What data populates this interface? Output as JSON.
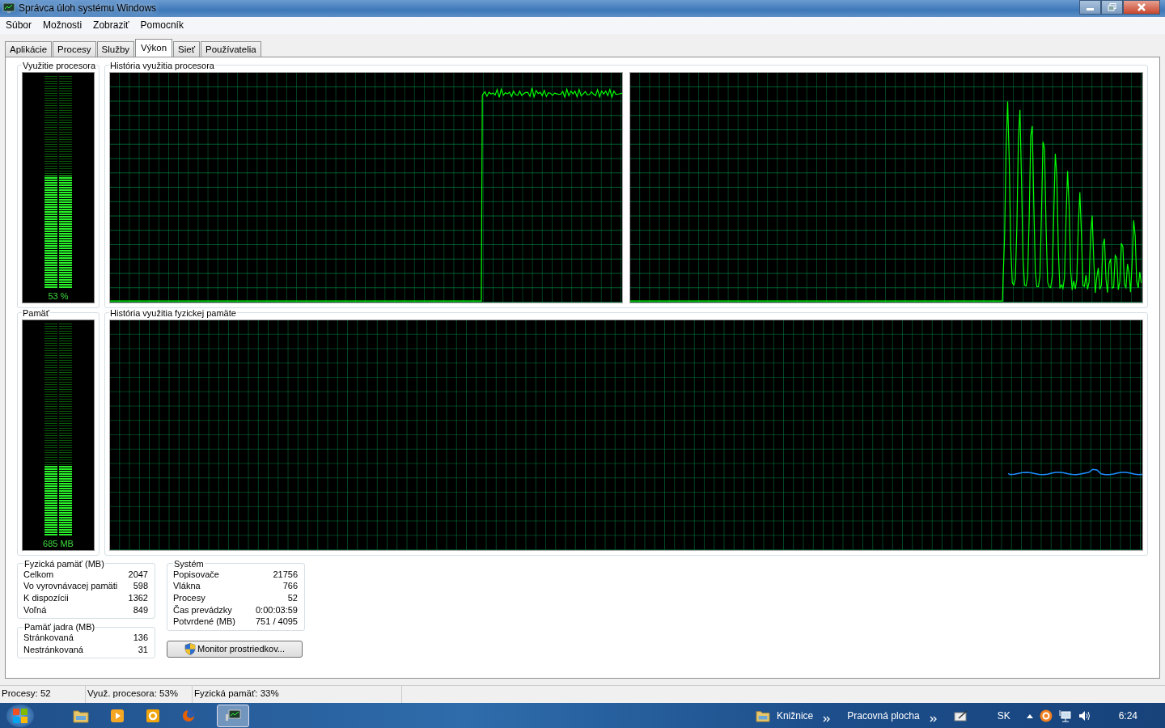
{
  "window": {
    "title": "Správca úloh systému Windows"
  },
  "menu": [
    "Súbor",
    "Možnosti",
    "Zobraziť",
    "Pomocník"
  ],
  "tabs": [
    {
      "label": "Aplikácie",
      "selected": false
    },
    {
      "label": "Procesy",
      "selected": false
    },
    {
      "label": "Služby",
      "selected": false
    },
    {
      "label": "Výkon",
      "selected": true
    },
    {
      "label": "Sieť",
      "selected": false
    },
    {
      "label": "Používatelia",
      "selected": false
    }
  ],
  "cpu_usage": {
    "title": "Využitie procesora",
    "reading": "53 %",
    "level": 0.53
  },
  "cpu_history": {
    "title": "História využitia procesora"
  },
  "memory": {
    "title": "Pamäť",
    "reading": "685 MB",
    "level": 0.33
  },
  "memory_history": {
    "title": "História využitia fyzickej pamäte"
  },
  "physical_memory": {
    "title": "Fyzická pamäť (MB)",
    "rows": [
      {
        "label": "Celkom",
        "value": "2047"
      },
      {
        "label": "Vo vyrovnávacej pamäti",
        "value": "598"
      },
      {
        "label": "K dispozícii",
        "value": "1362"
      },
      {
        "label": "Voľná",
        "value": "849"
      }
    ]
  },
  "kernel_memory": {
    "title": "Pamäť jadra (MB)",
    "rows": [
      {
        "label": "Stránkovaná",
        "value": "136"
      },
      {
        "label": "Nestránkovaná",
        "value": "31"
      }
    ]
  },
  "system": {
    "title": "Systém",
    "rows": [
      {
        "label": "Popisovače",
        "value": "21756"
      },
      {
        "label": "Vlákna",
        "value": "766"
      },
      {
        "label": "Procesy",
        "value": "52"
      },
      {
        "label": "Čas prevádzky",
        "value": "0:00:03:59"
      },
      {
        "label": "Potvrdené (MB)",
        "value": "751 / 4095"
      }
    ]
  },
  "resource_monitor_button": "Monitor prostriedkov...",
  "status_bar": [
    "Procesy: 52",
    "Využ. procesora: 53%",
    "Fyzická pamäť: 33%"
  ],
  "taskbar": {
    "toolbars": [
      "Knižnice",
      "Pracovná plocha"
    ],
    "language": "SK",
    "clock": "6:24"
  }
}
